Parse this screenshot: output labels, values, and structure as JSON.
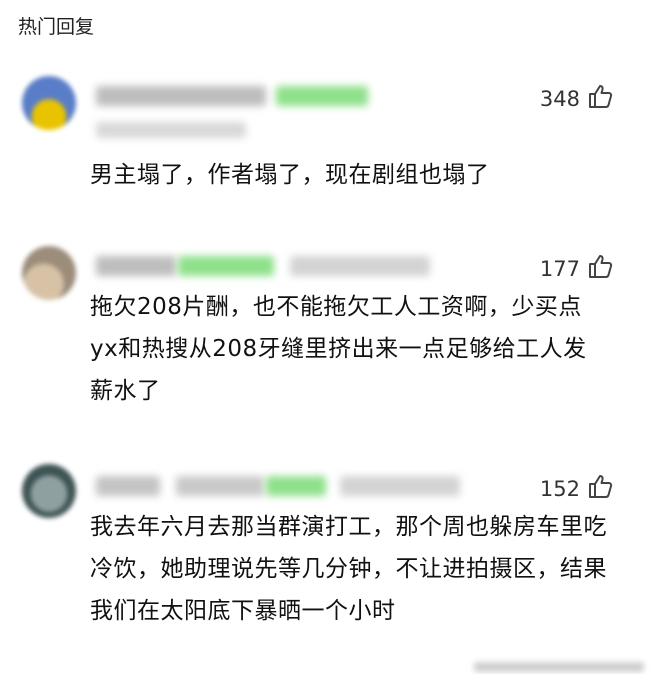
{
  "header": {
    "title": "热门回复"
  },
  "icons": {
    "like": "thumbs-up-icon"
  },
  "colors": {
    "blur_green": "#8ee08a",
    "blur_gray": "#cfcfcf"
  },
  "comments": [
    {
      "likes": "348",
      "text": "男主塌了，作者塌了，现在剧组也塌了"
    },
    {
      "likes": "177",
      "text": "拖欠208片酬，也不能拖欠工人工资啊，少买点yx和热搜从208牙缝里挤出来一点足够给工人发薪水了"
    },
    {
      "likes": "152",
      "text": "我去年六月去那当群演打工，那个周也躲房车里吃冷饮，她助理说先等几分钟，不让进拍摄区，结果我们在太阳底下暴晒一个小时"
    }
  ]
}
